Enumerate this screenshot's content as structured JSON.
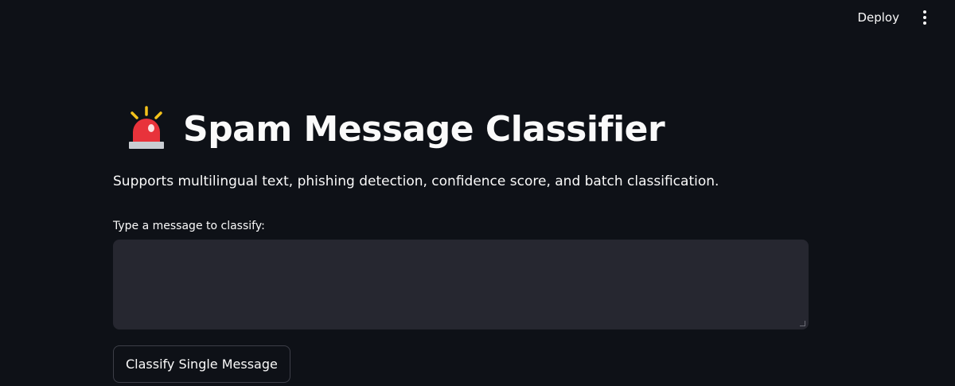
{
  "header": {
    "deploy_label": "Deploy",
    "menu_icon": "kebab-menu-icon"
  },
  "main": {
    "title_icon": "police-car-light-icon",
    "title": "Spam Message Classifier",
    "subtitle": "Supports multilingual text, phishing detection, confidence score, and batch classification.",
    "input_label": "Type a message to classify:",
    "input_value": "",
    "classify_button_label": "Classify Single Message"
  },
  "colors": {
    "background": "#0e1117",
    "input_background": "#262730",
    "text": "#fafafa",
    "siren_red": "#e8333b",
    "siren_rays": "#f4c21b"
  }
}
